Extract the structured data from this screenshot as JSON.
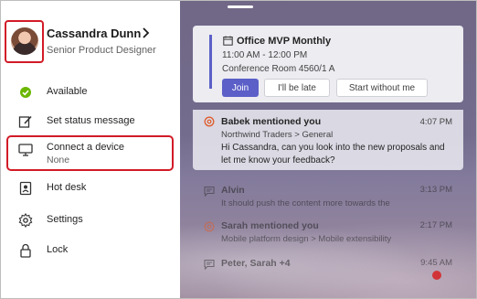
{
  "user": {
    "name": "Cassandra Dunn",
    "title": "Senior Product Designer"
  },
  "menu": [
    {
      "label": "Available",
      "icon": "available-status-icon"
    },
    {
      "label": "Set status message",
      "icon": "edit-status-icon"
    },
    {
      "label": "Connect a device",
      "sublabel": "None",
      "icon": "device-icon"
    },
    {
      "label": "Hot desk",
      "icon": "hot-desk-icon"
    },
    {
      "label": "Settings",
      "icon": "gear-icon"
    },
    {
      "label": "Lock",
      "icon": "lock-icon"
    }
  ],
  "meeting": {
    "title": "Office MVP Monthly",
    "time": "11:00 AM - 12:00 PM",
    "room": "Conference Room 4560/1 A",
    "join_label": "Join",
    "late_label": "I'll be late",
    "start_label": "Start without me"
  },
  "notifications": [
    {
      "title": "Babek mentioned you",
      "time": "4:07 PM",
      "subtitle": "Northwind Traders > General",
      "body": "Hi Cassandra, can you look into the new proposals and let me know your feedback?",
      "icon": "mention-icon"
    },
    {
      "title": "Alvin",
      "time": "3:13 PM",
      "subtitle": "It should push the content more towards the",
      "icon": "chat-icon"
    },
    {
      "title": "Sarah mentioned you",
      "time": "2:17 PM",
      "subtitle": "Mobile platform design > Mobile extensibility",
      "icon": "mention-icon"
    },
    {
      "title": "Peter, Sarah +4",
      "time": "9:45 AM",
      "icon": "chat-icon"
    }
  ],
  "colors": {
    "accent": "#5b5fc7",
    "highlight": "#d21b27",
    "available": "#6bb700"
  }
}
